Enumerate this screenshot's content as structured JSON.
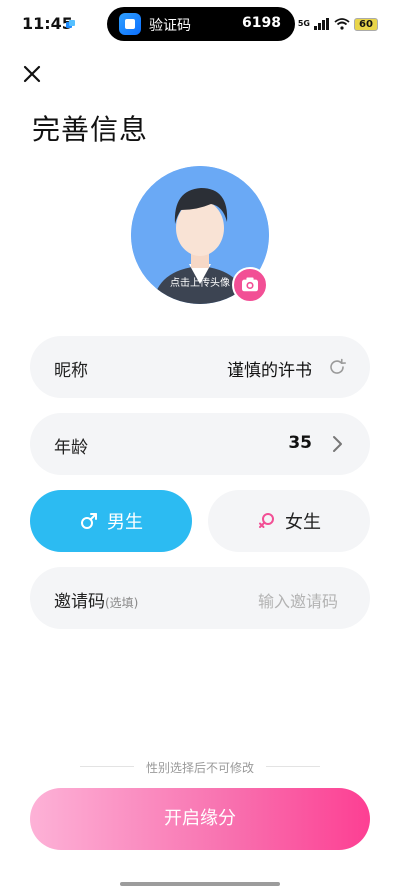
{
  "status_bar": {
    "time": "11:45",
    "island_label": "验证码",
    "island_code": "6198",
    "network": "5G",
    "battery": "60"
  },
  "page": {
    "title": "完善信息",
    "avatar_caption": "点击上传头像"
  },
  "form": {
    "nickname_label": "昵称",
    "nickname_value": "谨慎的许书",
    "age_label": "年龄",
    "age_value": "35",
    "gender_male": "男生",
    "gender_female": "女生",
    "selected_gender": "男生",
    "invite_label": "邀请码",
    "invite_hint": "(选填)",
    "invite_placeholder": "输入邀请码"
  },
  "notice": "性别选择后不可修改",
  "submit_label": "开启缘分",
  "colors": {
    "male_accent": "#2cbbf2",
    "female_accent": "#f24f95",
    "submit_gradient_end": "#fd3f93"
  }
}
